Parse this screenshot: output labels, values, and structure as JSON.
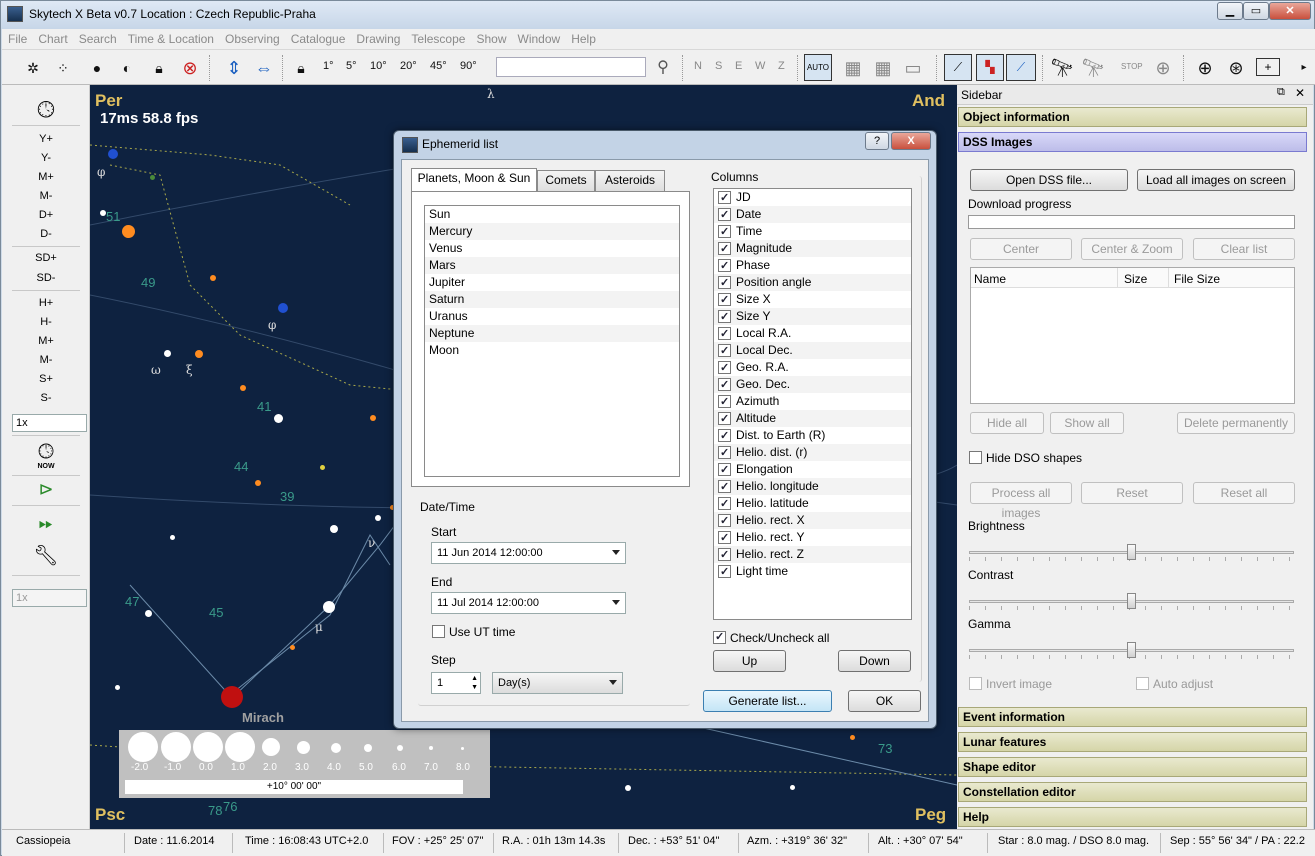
{
  "app": {
    "title": "Skytech X Beta v0.7   Location : Czech Republic-Praha"
  },
  "menu": [
    "File",
    "Chart",
    "Search",
    "Time & Location",
    "Observing",
    "Catalogue",
    "Drawing",
    "Telescope",
    "Show",
    "Window",
    "Help"
  ],
  "toolbar": {
    "fov_labels": [
      "1°",
      "5°",
      "10°",
      "20°",
      "45°",
      "90°"
    ],
    "search_placeholder": "",
    "compass": [
      "N",
      "S",
      "E",
      "W",
      "Z"
    ],
    "auto_label": "AUTO",
    "stop_label": "STOP"
  },
  "leftbar": {
    "buttons": [
      "Y+",
      "Y-",
      "M+",
      "M-",
      "D+",
      "D-",
      "SD+",
      "SD-",
      "H+",
      "H-",
      "M+",
      "M-",
      "S+",
      "S-"
    ],
    "speed_value": "1x",
    "speed2_value": "1x",
    "now_label": "NOW"
  },
  "sky": {
    "fps": "17ms 58.8 fps",
    "corner_labels": {
      "tl": "Per",
      "tr": "And",
      "bl": "Psc",
      "br": "Peg"
    },
    "star_name": "Mirach",
    "flamsteed": [
      "51",
      "49",
      "41",
      "44",
      "39",
      "47",
      "45",
      "73",
      "78",
      "76"
    ],
    "greek": [
      "φ",
      "φ",
      "ω",
      "ξ",
      "ν",
      "μ",
      "λ"
    ],
    "magnitude_scale": [
      "-2.0",
      "-1.0",
      "0.0",
      "1.0",
      "2.0",
      "3.0",
      "4.0",
      "5.0",
      "6.0",
      "7.0",
      "8.0"
    ],
    "scale_bar": "+10° 00' 00\""
  },
  "dialog": {
    "title": "Ephemerid list",
    "help_btn": "?",
    "close_btn": "X",
    "tabs": [
      "Planets, Moon & Sun",
      "Comets",
      "Asteroids"
    ],
    "objects": [
      "Sun",
      "Mercury",
      "Venus",
      "Mars",
      "Jupiter",
      "Saturn",
      "Uranus",
      "Neptune",
      "Moon"
    ],
    "datetime_group": "Date/Time",
    "start_label": "Start",
    "start_value": "11 Jun 2014 12:00:00",
    "end_label": "End",
    "end_value": "11 Jul 2014 12:00:00",
    "use_ut": "Use UT time",
    "step_label": "Step",
    "step_value": "1",
    "step_unit": "Day(s)",
    "columns_group": "Columns",
    "columns": [
      "JD",
      "Date",
      "Time",
      "Magnitude",
      "Phase",
      "Position angle",
      "Size X",
      "Size Y",
      "Local R.A.",
      "Local Dec.",
      "Geo. R.A.",
      "Geo. Dec.",
      "Azimuth",
      "Altitude",
      "Dist. to Earth (R)",
      "Helio. dist. (r)",
      "Elongation",
      "Helio. longitude",
      "Helio. latitude",
      "Helio. rect. X",
      "Helio. rect. Y",
      "Helio. rect. Z",
      "Light time"
    ],
    "check_all": "Check/Uncheck all",
    "up": "Up",
    "down": "Down",
    "generate": "Generate list...",
    "ok": "OK"
  },
  "sidebar": {
    "title": "Sidebar",
    "sections_top": [
      "Object information",
      "DSS Images"
    ],
    "open_dss": "Open DSS file...",
    "load_all": "Load all images on screen",
    "download_progress": "Download progress",
    "center": "Center",
    "center_zoom": "Center & Zoom",
    "clear_list": "Clear list",
    "col_name": "Name",
    "col_size": "Size",
    "col_file_size": "File Size",
    "hide_all": "Hide all",
    "show_all": "Show all",
    "delete_perm": "Delete permanently",
    "hide_dso": "Hide DSO shapes",
    "process_all": "Process all images",
    "reset": "Reset",
    "reset_all": "Reset all",
    "brightness": "Brightness",
    "contrast": "Contrast",
    "gamma": "Gamma",
    "brightness_level": 0.5,
    "contrast_level": 0.5,
    "gamma_level": 0.5,
    "invert": "Invert image",
    "auto_adjust": "Auto adjust",
    "sections_bottom": [
      "Event information",
      "Lunar features",
      "Shape editor",
      "Constellation editor",
      "Help"
    ]
  },
  "status": {
    "constellation": "Cassiopeia",
    "date": "Date : 11.6.2014",
    "time": "Time : 16:08:43 UTC+2.0",
    "fov": "FOV : +25° 25' 07\"",
    "ra": "R.A. : 01h 13m 14.3s",
    "dec": "Dec. : +53° 51' 04\"",
    "azm": "Azm. : +319° 36' 32\"",
    "alt": "Alt. : +30° 07' 54\"",
    "star": "Star : 8.0 mag. / DSO 8.0 mag.",
    "sep": "Sep : 55° 56' 34\" / PA : 22.2"
  },
  "colors": {
    "sky": "#0e2240",
    "section": "#d5d5a8",
    "section_active": "#bdbde9"
  }
}
